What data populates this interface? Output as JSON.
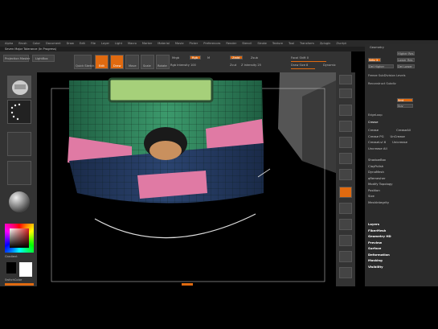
{
  "menubar": {
    "items": [
      "Alpha",
      "Brush",
      "Color",
      "Document",
      "Draw",
      "Edit",
      "File",
      "Layer",
      "Light",
      "Macro",
      "Marker",
      "Material",
      "Movie",
      "Picker",
      "Preferences",
      "Render",
      "Stencil",
      "Stroke",
      "Texture",
      "Tool",
      "Transform",
      "Zplugin",
      "Zscript"
    ]
  },
  "title": "Seven Major Tolerance (In Progress)",
  "toolbar": {
    "projection_label": "Projection Master",
    "lightbox_label": "LightBox",
    "quick_sketch_label": "Quick Sketch",
    "edit_label": "Edit",
    "draw_label": "Draw",
    "move_label": "Move",
    "scale_label": "Scale",
    "rotate_label": "Rotate",
    "mrgb_label": "Mrgb",
    "rgb_label": "Rgb",
    "m_label": "M",
    "zadd_label": "Zadd",
    "zsub_label": "Zsub",
    "zcut_label": "Zcut",
    "rgb_intensity_label": "Rgb Intensity 100",
    "z_intensity_label": "Z Intensity 25",
    "focal_shift_label": "Focal Shift 0",
    "draw_size_label": "Draw Size 8",
    "dynamic_label": "Dynamic"
  },
  "left_panel": {
    "gradient_label": "Gradient",
    "switch_color_label": "SwitchColor"
  },
  "right_panel": {
    "header": "Geometry",
    "buttons": [
      "Higher Res",
      "Lower Res",
      "Sdiv 3",
      "Del Lower",
      "Del Higher",
      "Freeze SubDivision Levels",
      "Reconstruct Subdiv"
    ],
    "smt_label": "Smt",
    "suv_label": "Suv",
    "edgeloop_label": "EdgeLoop",
    "crease_label": "Crease",
    "crease_items": [
      "Crease",
      "CreaseAll",
      "Crease PG",
      "UnCrease",
      "CreaseLvl 6",
      "Unicrease",
      "Uncrease All"
    ],
    "tools": [
      "ShadowBox",
      "ClayPolish",
      "DynaMesh",
      "qRemesher",
      "Modify Topology",
      "Position",
      "Size",
      "MeshIntegrity"
    ],
    "sections": [
      "Layers",
      "FiberMesh",
      "Geometry HD",
      "Preview",
      "Surface",
      "Deformation",
      "Masking",
      "Visibility"
    ]
  }
}
